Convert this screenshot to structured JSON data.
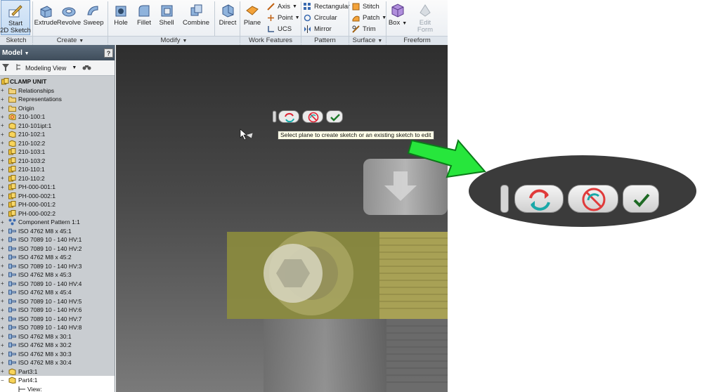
{
  "ribbon": {
    "groups": [
      {
        "label": "Sketch"
      },
      {
        "label": "Create"
      },
      {
        "label": "Modify"
      },
      {
        "label": "Work Features"
      },
      {
        "label": "Pattern"
      },
      {
        "label": "Surface"
      },
      {
        "label": "Freeform"
      }
    ],
    "start_sketch": {
      "line1": "Start",
      "line2": "2D Sketch"
    },
    "extrude": "Extrude",
    "revolve": "Revolve",
    "sweep": "Sweep",
    "hole": "Hole",
    "fillet": "Fillet",
    "shell": "Shell",
    "combine": "Combine",
    "direct": "Direct",
    "plane": "Plane",
    "axis": "Axis",
    "point": "Point",
    "ucs": "UCS",
    "rectangular": "Rectangular",
    "circular": "Circular",
    "mirror": "Mirror",
    "stitch": "Stitch",
    "patch": "Patch",
    "trim": "Trim",
    "box": "Box",
    "edit_form": {
      "line1": "Edit",
      "line2": "Form"
    }
  },
  "browser": {
    "title": "Model",
    "view_mode": "Modeling View",
    "help": "?",
    "tree": [
      {
        "label": "CLAMP UNIT",
        "icon": "assembly",
        "root": true
      },
      {
        "label": "Relationships",
        "icon": "folder"
      },
      {
        "label": "Representations",
        "icon": "folder"
      },
      {
        "label": "Origin",
        "icon": "folder"
      },
      {
        "label": "210-100:1",
        "icon": "part-flexible"
      },
      {
        "label": "210-101ipt:1",
        "icon": "part"
      },
      {
        "label": "210-102:1",
        "icon": "part-adaptive"
      },
      {
        "label": "210-102:2",
        "icon": "part"
      },
      {
        "label": "210-103:1",
        "icon": "assembly-adaptive"
      },
      {
        "label": "210-103:2",
        "icon": "assembly"
      },
      {
        "label": "210-110:1",
        "icon": "assembly"
      },
      {
        "label": "210-110:2",
        "icon": "assembly"
      },
      {
        "label": "PH-000-001:1",
        "icon": "assembly"
      },
      {
        "label": "PH-000-002:1",
        "icon": "assembly"
      },
      {
        "label": "PH-000-001:2",
        "icon": "assembly"
      },
      {
        "label": "PH-000-002:2",
        "icon": "assembly"
      },
      {
        "label": "Component Pattern 1:1",
        "icon": "pattern"
      },
      {
        "label": "ISO 4762 M8 x 45:1",
        "icon": "bolt"
      },
      {
        "label": "ISO 7089 10 - 140 HV:1",
        "icon": "bolt"
      },
      {
        "label": "ISO 7089 10 - 140 HV:2",
        "icon": "bolt"
      },
      {
        "label": "ISO 4762 M8 x 45:2",
        "icon": "bolt"
      },
      {
        "label": "ISO 7089 10 - 140 HV:3",
        "icon": "bolt"
      },
      {
        "label": "ISO 4762 M8 x 45:3",
        "icon": "bolt"
      },
      {
        "label": "ISO 7089 10 - 140 HV:4",
        "icon": "bolt"
      },
      {
        "label": "ISO 4762 M8 x 45:4",
        "icon": "bolt"
      },
      {
        "label": "ISO 7089 10 - 140 HV:5",
        "icon": "bolt"
      },
      {
        "label": "ISO 7089 10 - 140 HV:6",
        "icon": "bolt"
      },
      {
        "label": "ISO 7089 10 - 140 HV:7",
        "icon": "bolt"
      },
      {
        "label": "ISO 7089 10 - 140 HV:8",
        "icon": "bolt"
      },
      {
        "label": "ISO 4762 M8 x 30:1",
        "icon": "bolt"
      },
      {
        "label": "ISO 4762 M8 x 30:2",
        "icon": "bolt"
      },
      {
        "label": "ISO 4762 M8 x 30:3",
        "icon": "bolt"
      },
      {
        "label": "ISO 4762 M8 x 30:4",
        "icon": "bolt"
      },
      {
        "label": "Part3:1",
        "icon": "part"
      },
      {
        "label": "Part4:1",
        "icon": "part",
        "selected": true,
        "expanded": true
      },
      {
        "label": "View:",
        "icon": "sketch",
        "sub": true,
        "selected": true
      }
    ]
  },
  "viewport": {
    "tooltip": "Select plane to create sketch or an existing sketch to edit"
  },
  "colors": {
    "accent_green": "#27e63c",
    "model_yellow": "#8f8f3c",
    "panel_bg": "#c9cdd1"
  }
}
